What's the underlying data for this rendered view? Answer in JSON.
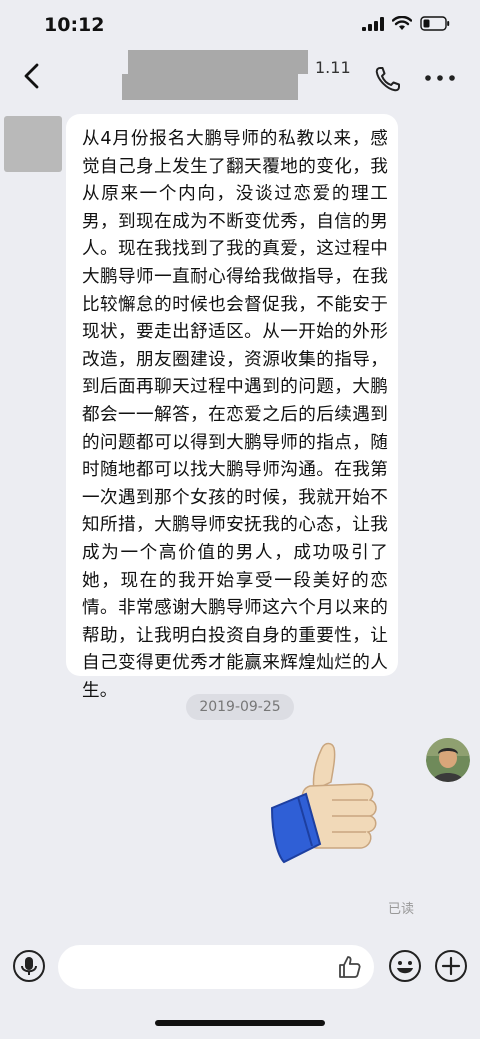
{
  "status_bar": {
    "time": "10:12",
    "icons": [
      "cellular-signal-icon",
      "wifi-icon",
      "battery-icon"
    ]
  },
  "header": {
    "title_redacted": true,
    "title_suffix": "1.11",
    "icons": [
      "back-chevron-icon",
      "phone-icon",
      "more-dots-icon"
    ]
  },
  "messages": [
    {
      "sender": "contact",
      "avatar_redacted": true,
      "text": "从4月份报名大鹏导师的私教以来，感觉自己身上发生了翻天覆地的变化，我从原来一个内向，没谈过恋爱的理工男，到现在成为不断变优秀，自信的男人。现在我找到了我的真爱，这过程中大鹏导师一直耐心得给我做指导，在我比较懈怠的时候也会督促我，不能安于现状，要走出舒适区。从一开始的外形改造，朋友圈建设，资源收集的指导，到后面再聊天过程中遇到的问题，大鹏都会一一解答，在恋爱之后的后续遇到的问题都可以得到大鹏导师的指点，随时随地都可以找大鹏导师沟通。在我第一次遇到那个女孩的时候，我就开始不知所措，大鹏导师安抚我的心态，让我成为一个高价值的男人，成功吸引了她，现在的我开始享受一段美好的恋情。非常感谢大鹏导师这六个月以来的帮助，让我明白投资自身的重要性，让自己变得更优秀才能赢来辉煌灿烂的人生。"
    }
  ],
  "timestamp": "2019-09-25",
  "reply": {
    "sender": "self",
    "sticker": "thumbs-up-sticker",
    "status": "已读"
  },
  "input_bar": {
    "placeholder": "",
    "icons": [
      "microphone-icon",
      "like-icon",
      "emoji-icon",
      "plus-icon"
    ]
  },
  "colors": {
    "background": "#ecedf2",
    "bubble": "#ffffff",
    "sleeve_blue": "#2f5fd6",
    "skin": "#f1d9b8",
    "redaction": "#a9a9a9"
  }
}
